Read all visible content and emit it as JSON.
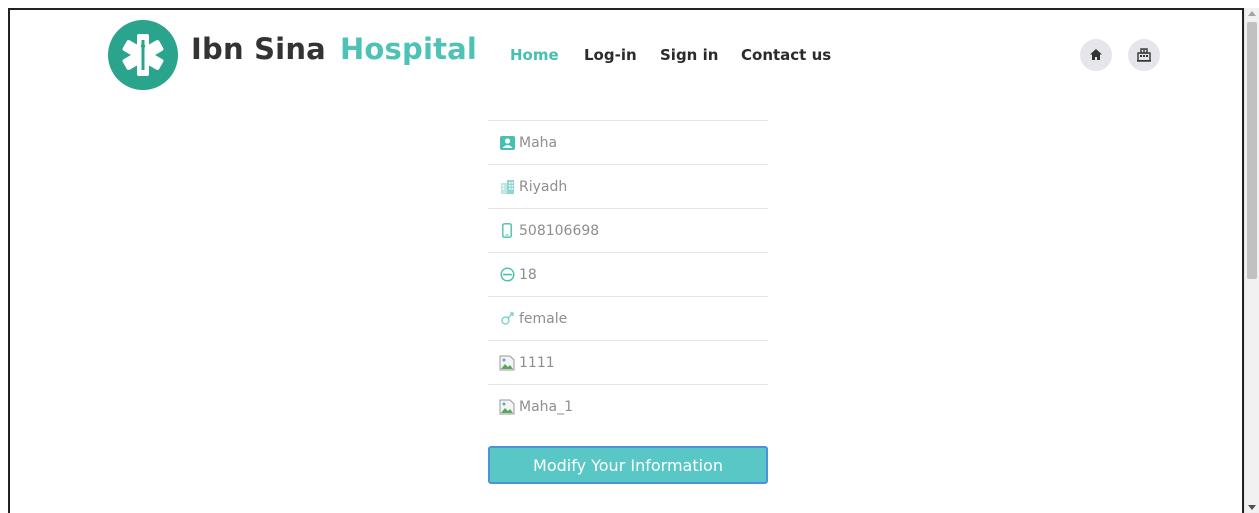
{
  "header": {
    "brand_part1": "Ibn Sina",
    "brand_part2": "Hospital",
    "logo_icon": "medical-star-icon",
    "nav": [
      {
        "label": "Home",
        "active": true
      },
      {
        "label": "Log-in",
        "active": false
      },
      {
        "label": "Sign in",
        "active": false
      },
      {
        "label": "Contact us",
        "active": false
      }
    ],
    "action_icons": [
      "home-icon",
      "hospital-icon"
    ]
  },
  "profile": {
    "fields": [
      {
        "icon": "person-card-icon",
        "value": "Maha"
      },
      {
        "icon": "buildings-icon",
        "value": "Riyadh"
      },
      {
        "icon": "phone-icon",
        "value": "508106698"
      },
      {
        "icon": "age-icon",
        "value": "18"
      },
      {
        "icon": "gender-icon",
        "value": "female"
      },
      {
        "icon": "broken-image-icon",
        "value": "1111"
      },
      {
        "icon": "broken-image-icon",
        "value": "Maha_1"
      }
    ],
    "button_label": "Modify Your Information"
  },
  "colors": {
    "accent": "#45c0b1",
    "logo": "#2aa48c",
    "button": "#59c7c5",
    "button_border": "#4a93dc"
  }
}
